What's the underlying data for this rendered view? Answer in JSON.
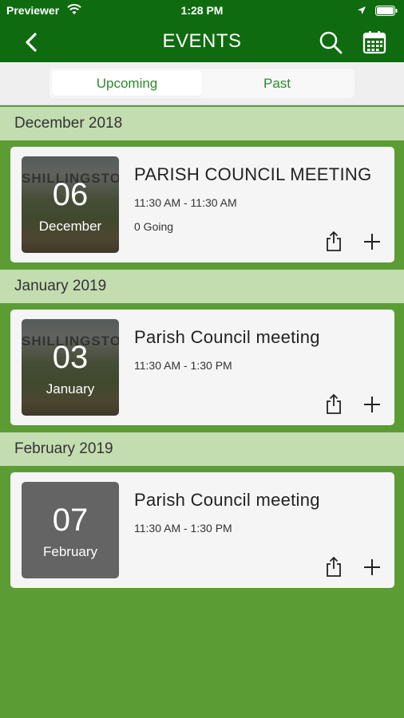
{
  "status_bar": {
    "carrier": "Previewer",
    "time": "1:28 PM",
    "icons": [
      "wifi-icon",
      "location-arrow-icon",
      "battery-icon"
    ]
  },
  "nav": {
    "title": "EVENTS",
    "icons": [
      "back-chevron-icon",
      "search-icon",
      "calendar-icon"
    ]
  },
  "tabs": [
    {
      "label": "Upcoming",
      "selected": true
    },
    {
      "label": "Past",
      "selected": false
    }
  ],
  "sections": [
    {
      "month": "December 2018",
      "events": [
        {
          "day": "06",
          "month_name": "December",
          "watermark": "SHILLINGSTON",
          "title": "PARISH COUNCIL MEETING",
          "time": "11:30 AM - 11:30 AM",
          "going": "0 Going"
        }
      ]
    },
    {
      "month": "January 2019",
      "events": [
        {
          "day": "03",
          "month_name": "January",
          "watermark": "SHILLINGSTON",
          "title": "Parish Council meeting",
          "time": "11:30 AM - 1:30 PM"
        }
      ]
    },
    {
      "month": "February 2019",
      "events": [
        {
          "day": "07",
          "month_name": "February",
          "title": "Parish Council meeting",
          "time": "11:30 AM - 1:30 PM"
        }
      ]
    }
  ],
  "colors": {
    "header_green": "#0f6b10",
    "background_green": "#5c9c35",
    "section_green": "#c3ddb1",
    "tab_text_green": "#2b8a2b",
    "plain_tile_gray": "#646464"
  }
}
